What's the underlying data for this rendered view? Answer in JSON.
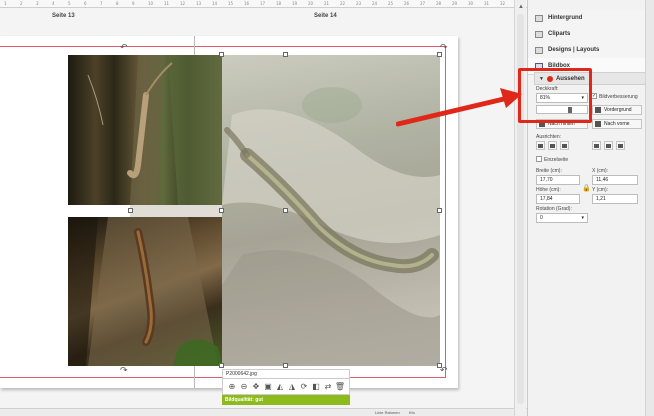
{
  "ruler": {
    "ticks": [
      "1",
      "2",
      "3",
      "4",
      "5",
      "6",
      "7",
      "8",
      "9",
      "10",
      "11",
      "12",
      "13",
      "14",
      "15",
      "16",
      "17",
      "18",
      "19",
      "20",
      "21",
      "22",
      "23",
      "24",
      "25",
      "26",
      "27",
      "28",
      "29",
      "30",
      "31",
      "32"
    ]
  },
  "canvas": {
    "page_left": "Seite 13",
    "page_right": "Seite 14"
  },
  "image_toolbar": {
    "filename": "P2000642.jpg",
    "quality": "Bildqualität: gut",
    "tools": [
      "zoom-in-icon",
      "zoom-out-icon",
      "move-icon",
      "crop-icon",
      "flip-icon",
      "mirror-icon",
      "rotate-icon",
      "mask-icon",
      "swap-icon",
      "delete-icon"
    ]
  },
  "zoom": {
    "label": "Linie Rahmen",
    "value": "Kfo"
  },
  "panel": {
    "sections": {
      "hintergrund": "Hintergrund",
      "cliparts": "Cliparts",
      "designs": "Designs | Layouts",
      "bildbox": "Bildbox"
    },
    "aussehen": {
      "title": "Aussehen",
      "deckkraft_label": "Deckkraft:",
      "deckkraft_value": "81%",
      "bildverbesserung": "Bildverbesserung",
      "vordergrund": "Vordergrund",
      "nach_hinten": "Nach hinten",
      "nach_vorne": "Nach vorne"
    },
    "ausrichten_label": "Ausrichten:",
    "einzelseite": "Einzelseite",
    "breite_label": "Breite (cm):",
    "breite_value": "17,70",
    "x_label": "X (cm):",
    "x_value": "11,46",
    "hoehe_label": "Höhe (cm):",
    "hoehe_value": "17,84",
    "y_label": "Y (cm):",
    "y_value": "1,21",
    "rotation_label": "Rotation (Grad):",
    "rotation_value": "0"
  },
  "colors": {
    "accent_red": "#e0281a",
    "quality_green": "#8dbb1d",
    "page_border": "#e35a6a"
  }
}
